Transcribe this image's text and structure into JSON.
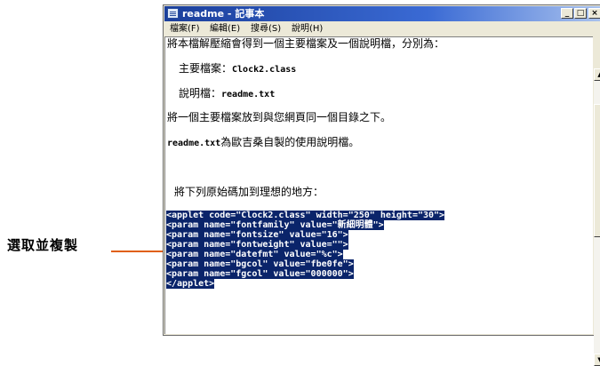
{
  "annotation": {
    "label": "選取並複製"
  },
  "window": {
    "title": "readme - 記事本",
    "buttons": {
      "minimize": "_",
      "maximize": "□",
      "close": "×"
    },
    "icon": "notepad-icon"
  },
  "menu": [
    "檔案(F)",
    "編輯(E)",
    "搜尋(S)",
    "說明(H)"
  ],
  "content": {
    "lines": [
      "將本檔解壓縮會得到一個主要檔案及一個說明檔，分別為：",
      "主要檔案：",
      "Clock2.class",
      "說明檔：",
      "readme.txt",
      "將一個主要檔案放到與您網頁同一個目錄之下。",
      "readme.txt",
      "為歐吉桑自製的使用說明檔。",
      "將下列原始碼加到理想的地方："
    ],
    "selected_code": [
      "<applet code=\"Clock2.class\" width=\"250\" height=\"30\">",
      "<param name=\"fontfamily\" value=\"新細明體\">",
      "<param name=\"fontsize\" value=\"16\">",
      "<param name=\"fontweight\" value=\"\">",
      "<param name=\"datefmt\" value=\"%c\">",
      "<param name=\"bgcol\" value=\"fbe0fe\">",
      "<param name=\"fgcol\" value=\"000000\">",
      "</applet>"
    ]
  },
  "scrollbar": {
    "up_icon": "▲",
    "down_icon": "▼"
  },
  "colors": {
    "selection": "#0a246a",
    "annotation_line": "#e06010",
    "titlebar": "#1b3f9b"
  }
}
